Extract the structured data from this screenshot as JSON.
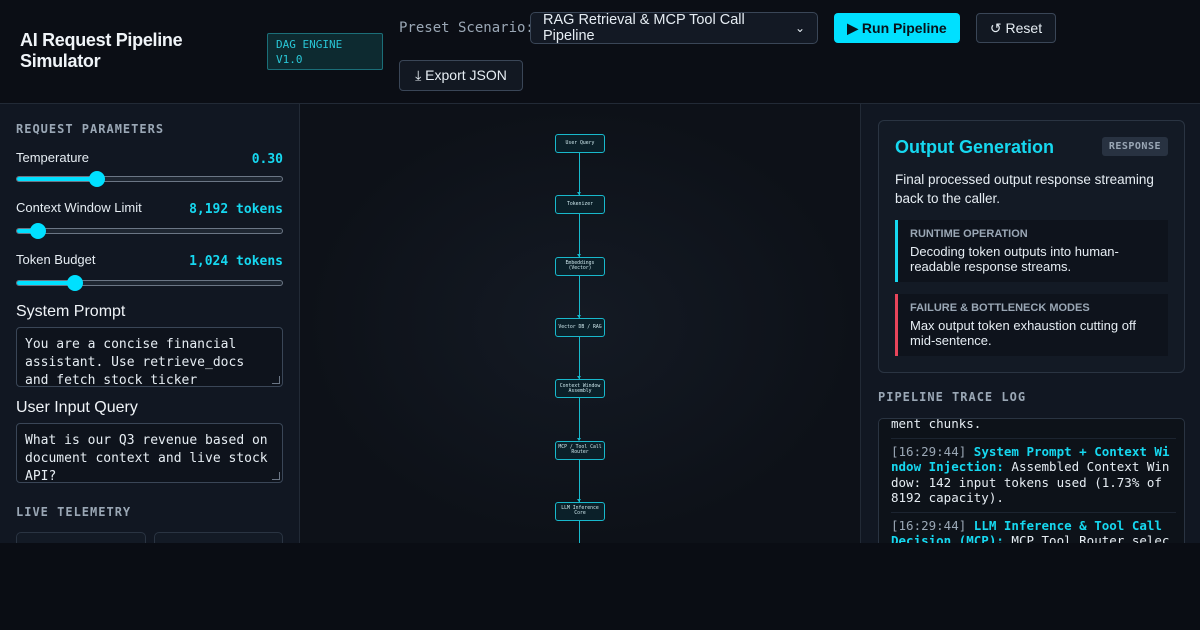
{
  "header": {
    "title": "AI Request Pipeline Simulator",
    "engine_badge": "DAG ENGINE V1.0",
    "preset_label": "Preset Scenario:",
    "preset_value": "RAG Retrieval & MCP Tool Call Pipeline",
    "run_label": "▶ Run Pipeline",
    "reset_label": "↺ Reset",
    "export_label": "⤓ Export JSON"
  },
  "left": {
    "section_title": "REQUEST PARAMETERS",
    "params": [
      {
        "label": "Temperature",
        "value": "0.30",
        "level": 0.3
      },
      {
        "label": "Context Window Limit",
        "value": "8,192 tokens",
        "level": 0.08
      },
      {
        "label": "Token Budget",
        "value": "1,024 tokens",
        "level": 0.22
      }
    ],
    "system_prompt_title": "System Prompt",
    "system_prompt_value": "You are a concise financial assistant. Use retrieve_docs and fetch stock ticker functions",
    "user_query_title": "User Input Query",
    "user_query_value": "What is our Q3 revenue based on document context and live stock API?",
    "telemetry_title": "LIVE TELEMETRY"
  },
  "pipeline": {
    "nodes": [
      "User Query",
      "Tokenizer",
      "Embeddings (Vector)",
      "Vector DB / RAG",
      "Context Window Assembly",
      "MCP / Tool Call Router",
      "LLM Inference Core"
    ]
  },
  "right": {
    "output_title": "Output Generation",
    "output_badge": "RESPONSE",
    "output_desc": "Final processed output response streaming back to the caller.",
    "runtime_title": "RUNTIME OPERATION",
    "runtime_text": "Decoding token outputs into human-readable response streams.",
    "failure_title": "FAILURE & BOTTLENECK MODES",
    "failure_text": "Max output token exhaustion cutting off mid-sentence.",
    "trace_title": "PIPELINE TRACE LOG",
    "trace_lead": "ment chunks.",
    "trace": [
      {
        "time": "[16:29:44]",
        "step": "System Prompt + Context Window Injection:",
        "msg": "Assembled Context Window: 142 input tokens used (1.73% of 8192 capacity)."
      },
      {
        "time": "[16:29:44]",
        "step": "LLM Inference & Tool Call Decision (MCP):",
        "msg": "MCP Tool Router selected"
      }
    ]
  },
  "colors": {
    "accent": "#00e0ff",
    "danger": "#e8455b",
    "background": "#0a0d14"
  }
}
